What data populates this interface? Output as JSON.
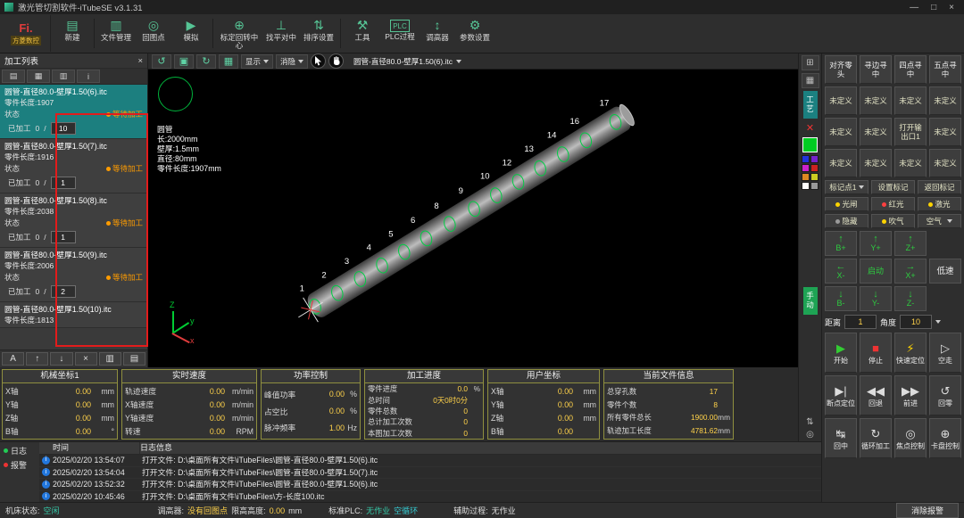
{
  "title_bar": {
    "title": "激光管切割软件-iTubeSE v3.1.31",
    "minimize": "—",
    "maximize": "□",
    "close": "×"
  },
  "brand": {
    "logo": "Fi.",
    "name": "方菱数控"
  },
  "toolbar": {
    "items": [
      {
        "label": "新建",
        "glyph": "▤"
      },
      {
        "label": "文件管理",
        "glyph": "▥"
      },
      {
        "label": "回图点",
        "glyph": "◎"
      },
      {
        "label": "模拟",
        "glyph": "▶"
      },
      {
        "label": "标定回转中心",
        "glyph": "⊕"
      },
      {
        "label": "找平对中",
        "glyph": "⊥"
      },
      {
        "label": "排序设置",
        "glyph": "⇅"
      },
      {
        "label": "工具",
        "glyph": "⚒"
      },
      {
        "label": "PLC过程",
        "glyph": "PLC"
      },
      {
        "label": "调高器",
        "glyph": "↕"
      },
      {
        "label": "参数设置",
        "glyph": "⚙"
      }
    ]
  },
  "left_panel": {
    "header": "加工列表",
    "view_icons": [
      "▤",
      "▦",
      "▥",
      "i"
    ],
    "done_sep": "/",
    "items": [
      {
        "name": "圆管-直径80.0-壁厚1.50(6).itc",
        "length": "零件长度:1907",
        "status_label": "状态",
        "badge": "等待加工",
        "done_label": "已加工",
        "done": "0",
        "total": "10"
      },
      {
        "name": "圆管-直径80.0-壁厚1.50(7).itc",
        "length": "零件长度:1916",
        "status_label": "状态",
        "badge": "等待加工",
        "done_label": "已加工",
        "done": "0",
        "total": "1"
      },
      {
        "name": "圆管-直径80.0-壁厚1.50(8).itc",
        "length": "零件长度:2038",
        "status_label": "状态",
        "badge": "等待加工",
        "done_label": "已加工",
        "done": "0",
        "total": "1"
      },
      {
        "name": "圆管-直径80.0-壁厚1.50(9).itc",
        "length": "零件长度:2006",
        "status_label": "状态",
        "badge": "等待加工",
        "done_label": "已加工",
        "done": "0",
        "total": "2"
      },
      {
        "name": "圆管-直径80.0-壁厚1.50(10).itc",
        "length": "零件长度:1813"
      }
    ],
    "tools": [
      {
        "glyph": "A"
      },
      {
        "glyph": "↑"
      },
      {
        "glyph": "↓"
      },
      {
        "glyph": "×"
      },
      {
        "glyph": "▥"
      },
      {
        "glyph": "▤"
      }
    ]
  },
  "canvas": {
    "toolbar": {
      "show_label": "显示",
      "hide_label": "消隐",
      "file_name": "圆管-直径80.0-壁厚1.50(6).itc",
      "icons": [
        {
          "glyph": "↺"
        },
        {
          "glyph": "▣"
        },
        {
          "glyph": "↻"
        },
        {
          "glyph": "▦"
        }
      ]
    },
    "info_lines": [
      "圆管",
      "长:2000mm",
      "壁厚:1.5mm",
      "直径:80mm",
      "零件长度:1907mm"
    ],
    "holes": [
      {
        "label": "1",
        "pos": 0.015
      },
      {
        "label": "2",
        "pos": 0.085
      },
      {
        "label": "3",
        "pos": 0.155
      },
      {
        "label": "4",
        "pos": 0.225
      },
      {
        "label": "5",
        "pos": 0.295
      },
      {
        "label": "6",
        "pos": 0.365
      },
      {
        "label": "8",
        "pos": 0.44
      },
      {
        "label": "9",
        "pos": 0.515
      },
      {
        "label": "10",
        "pos": 0.585
      },
      {
        "label": "12",
        "pos": 0.655
      },
      {
        "label": "13",
        "pos": 0.725
      },
      {
        "label": "14",
        "pos": 0.795
      },
      {
        "label": "16",
        "pos": 0.868
      },
      {
        "label": "17",
        "pos": 0.962
      }
    ],
    "axis": {
      "x": "x",
      "y": "y",
      "z": "Z"
    }
  },
  "strip": {
    "process_tab": "工艺",
    "manual_tab": "手动",
    "selected_color": "#00cc22",
    "colors": [
      "#2233dd",
      "#7722cc",
      "#cc22cc",
      "#cc2222",
      "#dd8822",
      "#cccc22",
      "#ffffff",
      "#999999"
    ]
  },
  "right_panel": {
    "probe_buttons": [
      "对齐零头",
      "寻边寻中",
      "四点寻中",
      "五点寻中"
    ],
    "macro_buttons": [
      "未定义",
      "未定义",
      "未定义",
      "未定义",
      "未定义",
      "未定义",
      "打开输出口1",
      "未定义",
      "未定义",
      "未定义",
      "未定义",
      "未定义"
    ],
    "marker": {
      "point": "标记点1",
      "set": "设置标记",
      "back": "返回标记"
    },
    "toggles": [
      {
        "label": "光闸",
        "dot": "#ffd400"
      },
      {
        "label": "红光",
        "dot": "#ff4040"
      },
      {
        "label": "激光",
        "dot": "#ffd400"
      },
      {
        "label": "隐藏",
        "dot": "#9a9a9a"
      },
      {
        "label": "吹气",
        "dot": "#ffd400"
      },
      {
        "label": "空气",
        "dot": "#9a9a9a"
      }
    ],
    "jog": {
      "b_plus": "B+",
      "y_plus": "Y+",
      "z_plus": "Z+",
      "x_minus": "X-",
      "start": "启动",
      "x_plus": "X+",
      "slow": "低速",
      "b_minus": "B-",
      "y_minus": "Y-",
      "z_minus": "Z-"
    },
    "step": {
      "distance_label": "距离",
      "distance": "1",
      "angle_label": "角度",
      "angle": "10"
    },
    "actions": [
      {
        "label": "开始",
        "glyph": "▶",
        "color": "#33cc33"
      },
      {
        "label": "停止",
        "glyph": "■",
        "color": "#ee3333"
      },
      {
        "label": "快速定位",
        "glyph": "⚡",
        "color": "#ffd400"
      },
      {
        "label": "空走",
        "glyph": "▷",
        "color": "#dddddd"
      },
      {
        "label": "断点定位",
        "glyph": "▶|",
        "color": "#dddddd"
      },
      {
        "label": "回退",
        "glyph": "◀◀",
        "color": "#dddddd"
      },
      {
        "label": "前进",
        "glyph": "▶▶",
        "color": "#dddddd"
      },
      {
        "label": "回零",
        "glyph": "↺",
        "color": "#dddddd"
      },
      {
        "label": "回中",
        "glyph": "↹",
        "color": "#dddddd"
      },
      {
        "label": "循环加工",
        "glyph": "↻",
        "color": "#dddddd"
      },
      {
        "label": "焦点控制",
        "glyph": "◎",
        "color": "#dddddd"
      },
      {
        "label": "卡盘控制",
        "glyph": "⊕",
        "color": "#dddddd"
      }
    ]
  },
  "status_panels": {
    "machine": {
      "title": "机械坐标1",
      "rows": [
        [
          "X轴",
          "0.00",
          "mm"
        ],
        [
          "Y轴",
          "0.00",
          "mm"
        ],
        [
          "Z轴",
          "0.00",
          "mm"
        ],
        [
          "B轴",
          "0.00",
          "°"
        ]
      ]
    },
    "speed": {
      "title": "实时速度",
      "rows": [
        [
          "轨迹速度",
          "0.00",
          "m/min"
        ],
        [
          "X轴速度",
          "0.00",
          "m/min"
        ],
        [
          "Y轴速度",
          "0.00",
          "m/min"
        ],
        [
          "转速",
          "0.00",
          "RPM"
        ]
      ]
    },
    "power": {
      "title": "功率控制",
      "rows": [
        [
          "峰值功率",
          "0.00",
          "%"
        ],
        [
          "占空比",
          "0.00",
          "%"
        ],
        [
          "脉冲频率",
          "1.00",
          "Hz"
        ]
      ]
    },
    "progress": {
      "title": "加工进度",
      "rows": [
        [
          "零件进度",
          "0.0",
          "%"
        ],
        [
          "总时间",
          "0天0时0分",
          ""
        ],
        [
          "零件总数",
          "0",
          ""
        ],
        [
          "总计加工次数",
          "0",
          ""
        ],
        [
          "本图加工次数",
          "0",
          ""
        ]
      ]
    },
    "user": {
      "title": "用户坐标",
      "rows": [
        [
          "X轴",
          "0.00",
          "mm"
        ],
        [
          "Y轴",
          "0.00",
          "mm"
        ],
        [
          "Z轴",
          "0.00",
          "mm"
        ],
        [
          "B轴",
          "0.00",
          ""
        ]
      ]
    },
    "file_info": {
      "title": "当前文件信息",
      "rows": [
        [
          "总穿孔数",
          "17",
          ""
        ],
        [
          "零件个数",
          "8",
          ""
        ],
        [
          "所有零件总长",
          "1900.00",
          "mm"
        ],
        [
          "轨迹加工长度",
          "4781.62",
          "mm"
        ]
      ]
    }
  },
  "log": {
    "tabs": [
      {
        "label": "日志",
        "dot": "#22cc55"
      },
      {
        "label": "报警",
        "dot": "#ee3333"
      }
    ],
    "columns": [
      "时间",
      "日志信息"
    ],
    "rows": [
      [
        "2025/02/20 13:54:07",
        "打开文件: D:\\桌面所有文件\\iTubeFiles\\圆管-直径80.0-壁厚1.50(6).itc"
      ],
      [
        "2025/02/20 13:54:04",
        "打开文件: D:\\桌面所有文件\\iTubeFiles\\圆管-直径80.0-壁厚1.50(7).itc"
      ],
      [
        "2025/02/20 13:52:32",
        "打开文件: D:\\桌面所有文件\\iTubeFiles\\圆管-直径80.0-壁厚1.50(6).itc"
      ],
      [
        "2025/02/20 10:45:46",
        "打开文件: D:\\桌面所有文件\\iTubeFiles\\方-长度100.itc"
      ]
    ]
  },
  "status_bar": {
    "machine_label": "机床状态:",
    "machine_value": "空闲",
    "hc_label": "调高器:",
    "hc_value": "没有回图点",
    "limit_label": "限高高度:",
    "limit_value": "0.00",
    "limit_unit": "mm",
    "plc_label": "标准PLC:",
    "plc_value1": "无作业",
    "plc_value2": "空循环",
    "aux_label": "辅助过程:",
    "aux_value": "无作业",
    "clear_alarm": "消除报警"
  }
}
